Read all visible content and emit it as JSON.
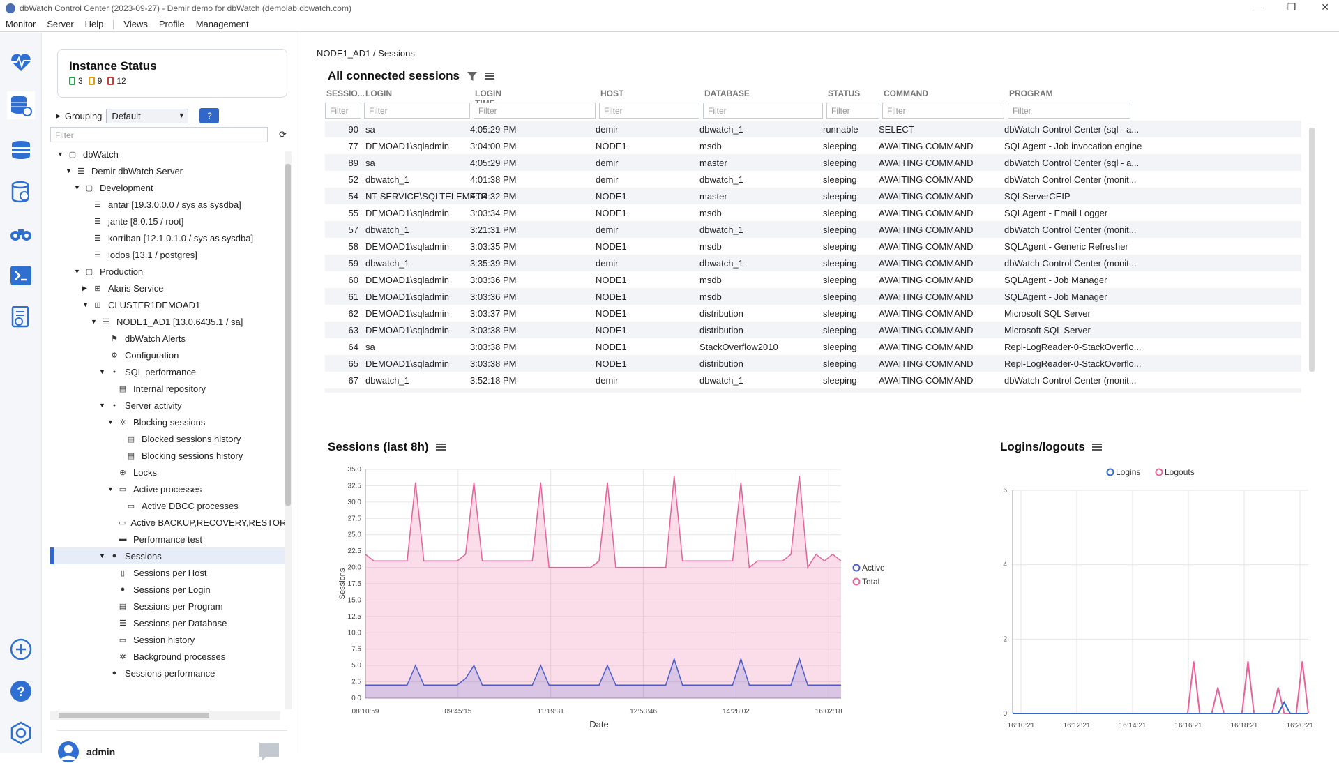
{
  "window": {
    "title": "dbWatch Control Center  (2023-09-27) - Demir demo for dbWatch (demolab.dbwatch.com)",
    "min": "—",
    "restore": "❐",
    "close": "✕"
  },
  "menu": {
    "monitor": "Monitor",
    "server": "Server",
    "help": "Help",
    "views": "Views",
    "profile": "Profile",
    "management": "Management"
  },
  "instance_status": {
    "title": "Instance Status",
    "green": "3",
    "orange": "9",
    "red": "12"
  },
  "grouping": {
    "label": "Grouping",
    "value": "Default",
    "help": "?"
  },
  "tree_filter": {
    "placeholder": "Filter"
  },
  "tree": [
    {
      "label": "dbWatch",
      "icon": "folder-icon",
      "depth": 0,
      "arrow": "▼"
    },
    {
      "label": "Demir dbWatch Server",
      "icon": "server-icon",
      "depth": 1,
      "arrow": "▼"
    },
    {
      "label": "Development",
      "icon": "folder-icon",
      "depth": 2,
      "arrow": "▼"
    },
    {
      "label": "antar [19.3.0.0.0 / sys as sysdba]",
      "icon": "server-icon",
      "depth": 3,
      "arrow": ""
    },
    {
      "label": "jante [8.0.15 / root]",
      "icon": "server-icon",
      "depth": 3,
      "arrow": ""
    },
    {
      "label": "korriban [12.1.0.1.0 / sys as sysdba]",
      "icon": "server-icon",
      "depth": 3,
      "arrow": ""
    },
    {
      "label": "lodos [13.1 / postgres]",
      "icon": "server-icon",
      "depth": 3,
      "arrow": ""
    },
    {
      "label": "Production",
      "icon": "folder-icon",
      "depth": 2,
      "arrow": "▼"
    },
    {
      "label": "Alaris Service",
      "icon": "cluster-icon",
      "depth": 3,
      "arrow": "▶"
    },
    {
      "label": "CLUSTER1DEMOAD1",
      "icon": "cluster-icon",
      "depth": 3,
      "arrow": "▼"
    },
    {
      "label": "NODE1_AD1 [13.0.6435.1 / sa]",
      "icon": "server-icon",
      "depth": 4,
      "arrow": "▼"
    },
    {
      "label": "dbWatch Alerts",
      "icon": "alert-icon",
      "depth": 5,
      "arrow": ""
    },
    {
      "label": "Configuration",
      "icon": "config-icon",
      "depth": 5,
      "arrow": ""
    },
    {
      "label": "SQL performance",
      "icon": "dot-icon",
      "depth": 5,
      "arrow": "▼"
    },
    {
      "label": "Internal repository",
      "icon": "repo-icon",
      "depth": 6,
      "arrow": ""
    },
    {
      "label": "Server activity",
      "icon": "dot-icon",
      "depth": 5,
      "arrow": "▼"
    },
    {
      "label": "Blocking sessions",
      "icon": "gear-icon",
      "depth": 6,
      "arrow": "▼"
    },
    {
      "label": "Blocked sessions history",
      "icon": "report-icon",
      "depth": 7,
      "arrow": ""
    },
    {
      "label": "Blocking sessions history",
      "icon": "report-icon",
      "depth": 7,
      "arrow": ""
    },
    {
      "label": "Locks",
      "icon": "globe-icon",
      "depth": 6,
      "arrow": ""
    },
    {
      "label": "Active processes",
      "icon": "window-icon",
      "depth": 6,
      "arrow": "▼"
    },
    {
      "label": "Active DBCC processes",
      "icon": "window-icon",
      "depth": 7,
      "arrow": ""
    },
    {
      "label": "Active BACKUP,RECOVERY,RESTORE",
      "icon": "window-icon",
      "depth": 7,
      "arrow": ""
    },
    {
      "label": "Performance test",
      "icon": "perf-icon",
      "depth": 6,
      "arrow": ""
    },
    {
      "label": "Sessions",
      "icon": "user-icon",
      "depth": 5,
      "arrow": "▼",
      "selected": true
    },
    {
      "label": "Sessions per Host",
      "icon": "host-icon",
      "depth": 6,
      "arrow": ""
    },
    {
      "label": "Sessions per Login",
      "icon": "user-icon",
      "depth": 6,
      "arrow": ""
    },
    {
      "label": "Sessions per Program",
      "icon": "report-icon",
      "depth": 6,
      "arrow": ""
    },
    {
      "label": "Sessions per Database",
      "icon": "server-icon",
      "depth": 6,
      "arrow": ""
    },
    {
      "label": "Session history",
      "icon": "history-icon",
      "depth": 6,
      "arrow": ""
    },
    {
      "label": "Background processes",
      "icon": "gear-icon",
      "depth": 6,
      "arrow": ""
    },
    {
      "label": "Sessions performance",
      "icon": "user-icon",
      "depth": 5,
      "arrow": ""
    }
  ],
  "user": {
    "name": "admin"
  },
  "breadcrumb": "NODE1_AD1 / Sessions",
  "sessions_table": {
    "title": "All connected sessions",
    "filter_placeholder": "Filter",
    "columns": [
      "SESSIO...",
      "LOGIN",
      "LOGIN TIME",
      "HOST",
      "DATABASE",
      "STATUS",
      "COMMAND",
      "PROGRAM"
    ],
    "rows": [
      [
        "90",
        "sa",
        "4:05:29 PM",
        "demir",
        "dbwatch_1",
        "runnable",
        "SELECT",
        "dbWatch Control Center (sql - a..."
      ],
      [
        "77",
        "DEMOAD1\\sqladmin",
        "3:04:00 PM",
        "NODE1",
        "msdb",
        "sleeping",
        "AWAITING COMMAND",
        "SQLAgent - Job invocation engine"
      ],
      [
        "89",
        "sa",
        "4:05:29 PM",
        "demir",
        "master",
        "sleeping",
        "AWAITING COMMAND",
        "dbWatch Control Center (sql - a..."
      ],
      [
        "52",
        "dbwatch_1",
        "4:01:38 PM",
        "demir",
        "dbwatch_1",
        "sleeping",
        "AWAITING COMMAND",
        "dbWatch Control Center (monit..."
      ],
      [
        "54",
        "NT SERVICE\\SQLTELEMETRY",
        "4:04:32 PM",
        "NODE1",
        "master",
        "sleeping",
        "AWAITING COMMAND",
        "SQLServerCEIP"
      ],
      [
        "55",
        "DEMOAD1\\sqladmin",
        "3:03:34 PM",
        "NODE1",
        "msdb",
        "sleeping",
        "AWAITING COMMAND",
        "SQLAgent - Email Logger"
      ],
      [
        "57",
        "dbwatch_1",
        "3:21:31 PM",
        "demir",
        "dbwatch_1",
        "sleeping",
        "AWAITING COMMAND",
        "dbWatch Control Center (monit..."
      ],
      [
        "58",
        "DEMOAD1\\sqladmin",
        "3:03:35 PM",
        "NODE1",
        "msdb",
        "sleeping",
        "AWAITING COMMAND",
        "SQLAgent - Generic Refresher"
      ],
      [
        "59",
        "dbwatch_1",
        "3:35:39 PM",
        "demir",
        "dbwatch_1",
        "sleeping",
        "AWAITING COMMAND",
        "dbWatch Control Center (monit..."
      ],
      [
        "60",
        "DEMOAD1\\sqladmin",
        "3:03:36 PM",
        "NODE1",
        "msdb",
        "sleeping",
        "AWAITING COMMAND",
        "SQLAgent - Job Manager"
      ],
      [
        "61",
        "DEMOAD1\\sqladmin",
        "3:03:36 PM",
        "NODE1",
        "msdb",
        "sleeping",
        "AWAITING COMMAND",
        "SQLAgent - Job Manager"
      ],
      [
        "62",
        "DEMOAD1\\sqladmin",
        "3:03:37 PM",
        "NODE1",
        "distribution",
        "sleeping",
        "AWAITING COMMAND",
        "Microsoft SQL Server"
      ],
      [
        "63",
        "DEMOAD1\\sqladmin",
        "3:03:38 PM",
        "NODE1",
        "distribution",
        "sleeping",
        "AWAITING COMMAND",
        "Microsoft SQL Server"
      ],
      [
        "64",
        "sa",
        "3:03:38 PM",
        "NODE1",
        "StackOverflow2010",
        "sleeping",
        "AWAITING COMMAND",
        "Repl-LogReader-0-StackOverflo..."
      ],
      [
        "65",
        "DEMOAD1\\sqladmin",
        "3:03:38 PM",
        "NODE1",
        "distribution",
        "sleeping",
        "AWAITING COMMAND",
        "Repl-LogReader-0-StackOverflo..."
      ],
      [
        "67",
        "dbwatch_1",
        "3:52:18 PM",
        "demir",
        "dbwatch_1",
        "sleeping",
        "AWAITING COMMAND",
        "dbWatch Control Center (monit..."
      ]
    ]
  },
  "chart_data": [
    {
      "type": "area",
      "title": "Sessions (last 8h)",
      "xlabel": "Date",
      "ylabel": "Sessions",
      "ylim": [
        0,
        35
      ],
      "yticks": [
        "0.0",
        "2.5",
        "5.0",
        "7.5",
        "10.0",
        "12.5",
        "15.0",
        "17.5",
        "20.0",
        "22.5",
        "25.0",
        "27.5",
        "30.0",
        "32.5",
        "35.0"
      ],
      "xticks": [
        "08:10:59",
        "09:45:15",
        "11:19:31",
        "12:53:46",
        "14:28:02",
        "16:02:18"
      ],
      "legend": "right",
      "series": [
        {
          "name": "Total",
          "color": "#e8629a",
          "values": [
            22,
            21,
            21,
            21,
            21,
            21,
            33,
            21,
            21,
            21,
            21,
            21,
            22,
            33,
            21,
            21,
            21,
            21,
            21,
            21,
            21,
            33,
            20,
            20,
            20,
            20,
            20,
            20,
            21,
            33,
            20,
            20,
            20,
            20,
            20,
            20,
            20,
            34,
            21,
            21,
            21,
            21,
            21,
            21,
            21,
            33,
            20,
            21,
            21,
            21,
            21,
            22,
            34,
            20,
            22,
            21,
            22,
            21
          ]
        },
        {
          "name": "Active",
          "color": "#4a5ccf",
          "values": [
            2,
            2,
            2,
            2,
            2,
            2,
            5,
            2,
            2,
            2,
            2,
            2,
            3,
            5,
            2,
            2,
            2,
            2,
            2,
            2,
            2,
            5,
            2,
            2,
            2,
            2,
            2,
            2,
            2,
            5,
            2,
            2,
            2,
            2,
            2,
            2,
            2,
            6,
            2,
            2,
            2,
            2,
            2,
            2,
            2,
            6,
            2,
            2,
            2,
            2,
            2,
            2,
            6,
            2,
            2,
            2,
            2,
            2
          ]
        }
      ]
    },
    {
      "type": "line",
      "title": "Logins/logouts",
      "ylim": [
        0,
        6
      ],
      "yticks": [
        "0",
        "2",
        "4",
        "6"
      ],
      "xticks": [
        "16:10:21",
        "16:12:21",
        "16:14:21",
        "16:16:21",
        "16:18:21",
        "16:20:21"
      ],
      "legend": "top",
      "series": [
        {
          "name": "Logins",
          "color": "#3067c8",
          "values": [
            0,
            0,
            0,
            0,
            0,
            0,
            0,
            0,
            0,
            0,
            0,
            0,
            0,
            0,
            0,
            0,
            0,
            0,
            0,
            0,
            0,
            0,
            0,
            0,
            0,
            0,
            0,
            0,
            0,
            0,
            0,
            0,
            0,
            0,
            0,
            0,
            0,
            0,
            0,
            0,
            0,
            0,
            0,
            0,
            0,
            0.3,
            0,
            0,
            0,
            0
          ]
        },
        {
          "name": "Logouts",
          "color": "#e8629a",
          "values": [
            0,
            0,
            0,
            0,
            0,
            0,
            0,
            0,
            0,
            0,
            0,
            0,
            0,
            0,
            0,
            0,
            0,
            0,
            0,
            0,
            0,
            0,
            0,
            0,
            0,
            0,
            0,
            0,
            0,
            0,
            1.4,
            0,
            0,
            0,
            0.7,
            0,
            0,
            0,
            0,
            1.4,
            0,
            0,
            0,
            0,
            0.7,
            0,
            0,
            0,
            1.4,
            0
          ]
        }
      ]
    }
  ]
}
